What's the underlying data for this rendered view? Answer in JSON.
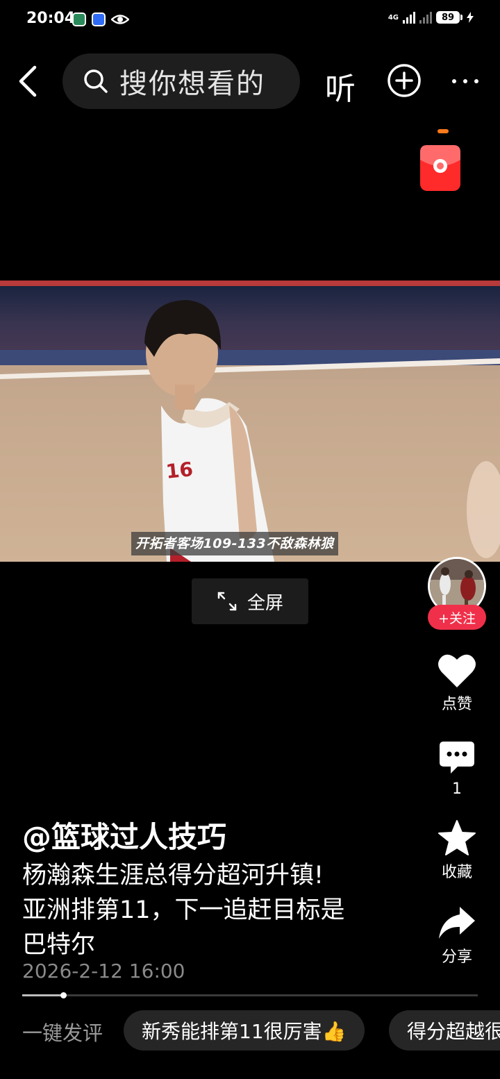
{
  "status_bar": {
    "time": "20:04",
    "network": "4G",
    "battery": "89"
  },
  "top_bar": {
    "search_placeholder": "搜你想看的",
    "listen_label": "听"
  },
  "video": {
    "subtitle": "开拓者客场109-133不敌森林狼",
    "jersey_number": "16",
    "fullscreen_label": "全屏"
  },
  "right_rail": {
    "follow_label": "+关注",
    "like_label": "点赞",
    "comment_count": "1",
    "favorite_label": "收藏",
    "share_label": "分享"
  },
  "caption": {
    "author": "@篮球过人技巧",
    "description_lines": [
      "杨瀚森生涯总得分超河升镇!",
      "亚洲排第11，下一追赶目标是",
      "巴特尔"
    ],
    "date": "2026-2-12 16:00"
  },
  "progress": {
    "fraction": 0.09
  },
  "quick_comment": {
    "label": "一键发评",
    "chips": [
      "新秀能排第11很厉害👍",
      "得分超越很"
    ]
  },
  "colors": {
    "accent_red": "#f0304a",
    "background": "#000000"
  }
}
